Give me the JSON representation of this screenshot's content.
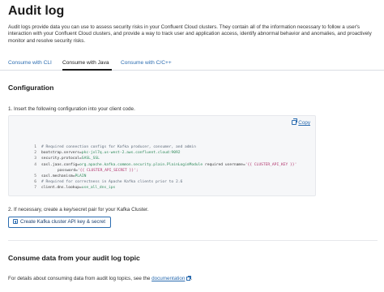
{
  "page": {
    "title": "Audit log",
    "intro": "Audit logs provide data you can use to assess security risks in your Confluent Cloud clusters. They contain all of the information necessary to follow a user's interaction with your Confluent Cloud clusters, and provide a way to track user and application access, identify abnormal behavior and anomalies, and proactively monitor and resolve security risks."
  },
  "tabs": [
    {
      "label": "Consume with CLI",
      "active": false
    },
    {
      "label": "Consume with Java",
      "active": true
    },
    {
      "label": "Consume with C/C++",
      "active": false
    }
  ],
  "configuration": {
    "heading": "Configuration",
    "step1": "1. Insert the following configuration into your client code.",
    "copy_label": "Copy",
    "code_lines": [
      {
        "num": "1",
        "comment": "# Required connection configs for Kafka producer, consumer, and admin"
      },
      {
        "num": "2",
        "key": "bootstrap.servers=",
        "value": "pkc-jxl7q.us-west-2.aws.confluent.cloud:9092"
      },
      {
        "num": "3",
        "key": "security.protocol=",
        "value": "SASL_SSL"
      },
      {
        "num": "4",
        "key": "sasl.jaas.config=",
        "value": "org.apache.kafka.common.security.plain.PlainLoginModule",
        "rest": "   required username=",
        "placeholder": "'{{ CLUSTER_API_KEY }}'"
      },
      {
        "num": "",
        "continuation": true,
        "key": "password=",
        "placeholder": "'{{ CLUSTER_API_SECRET }}';"
      },
      {
        "num": "5",
        "key": "sasl.mechanism=",
        "value": "PLAIN"
      },
      {
        "num": "6",
        "comment": "# Required for correctness in Apache Kafka clients prior to 2.6"
      },
      {
        "num": "7",
        "key": "client.dns.lookup=",
        "value": "use_all_dns_ips"
      }
    ],
    "step2": "2. If necessary, create a key/secret pair for your Kafka Cluster.",
    "create_button": "Create Kafka cluster API key & secret"
  },
  "consume": {
    "heading": "Consume data from your audit log topic",
    "details_prefix": "For details about consuming data from audit log topics, see the ",
    "link_text": "documentation",
    "details_suffix": "."
  },
  "icons": {
    "copy": "copy-icon",
    "add": "plus-square-icon",
    "external": "external-link-icon"
  },
  "colors": {
    "link": "#2b6cb0",
    "code_value": "#2f8a5a",
    "code_placeholder": "#b0336b",
    "code_background": "#f6f7f9"
  }
}
